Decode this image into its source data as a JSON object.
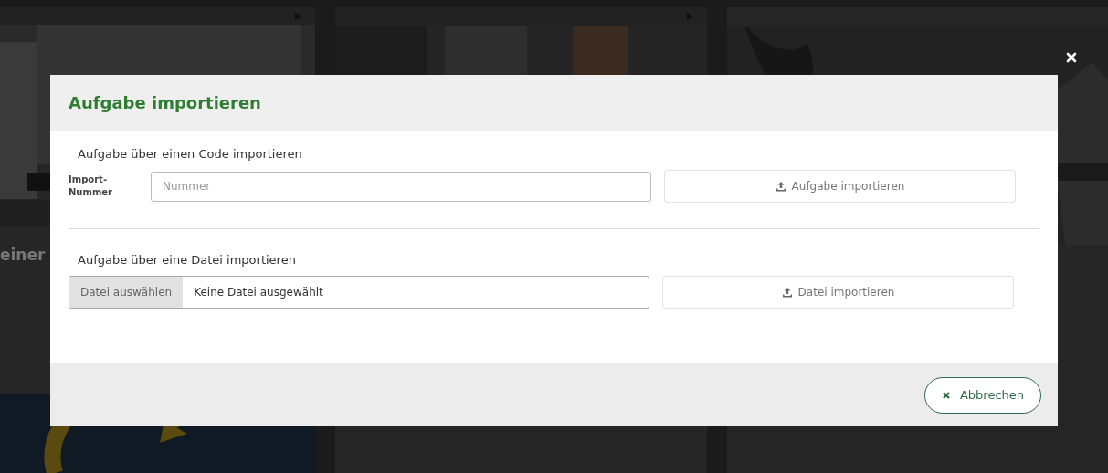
{
  "background": {
    "card_heading": "einer"
  },
  "dialog": {
    "title": "Aufgabe importieren",
    "sections": [
      {
        "kind": "code",
        "heading": "Aufgabe über einen Code importieren",
        "label": "Import-Nummer",
        "placeholder": "Nummer",
        "button": "Aufgabe importieren"
      },
      {
        "kind": "file",
        "heading": "Aufgabe über eine Datei importieren",
        "picker": "Datei auswählen",
        "file_status": "Keine Datei ausgewählt",
        "button": "Datei importieren"
      }
    ],
    "cancel": "Abbrechen"
  }
}
